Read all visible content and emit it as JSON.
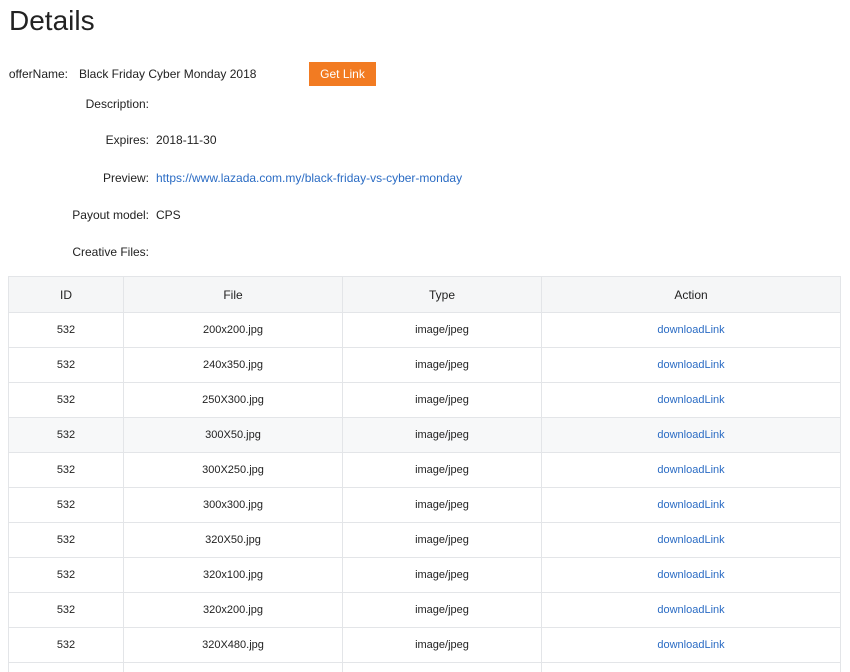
{
  "page": {
    "title": "Details"
  },
  "details": {
    "offer_name_label": "offerName:",
    "offer_name_value": "Black Friday Cyber Monday 2018",
    "get_link_label": "Get Link",
    "description_label": "Description:",
    "description_value": "",
    "expires_label": "Expires:",
    "expires_value": "2018-11-30",
    "preview_label": "Preview:",
    "preview_value": "https://www.lazada.com.my/black-friday-vs-cyber-monday",
    "payout_label": "Payout model:",
    "payout_value": "CPS",
    "creative_label": "Creative Files:"
  },
  "table": {
    "columns": [
      "ID",
      "File",
      "Type",
      "Action"
    ],
    "rows": [
      {
        "id": "532",
        "file": "200x200.jpg",
        "type": "image/jpeg",
        "action": "downloadLink"
      },
      {
        "id": "532",
        "file": "240x350.jpg",
        "type": "image/jpeg",
        "action": "downloadLink"
      },
      {
        "id": "532",
        "file": "250X300.jpg",
        "type": "image/jpeg",
        "action": "downloadLink"
      },
      {
        "id": "532",
        "file": "300X50.jpg",
        "type": "image/jpeg",
        "action": "downloadLink"
      },
      {
        "id": "532",
        "file": "300X250.jpg",
        "type": "image/jpeg",
        "action": "downloadLink"
      },
      {
        "id": "532",
        "file": "300x300.jpg",
        "type": "image/jpeg",
        "action": "downloadLink"
      },
      {
        "id": "532",
        "file": "320X50.jpg",
        "type": "image/jpeg",
        "action": "downloadLink"
      },
      {
        "id": "532",
        "file": "320x100.jpg",
        "type": "image/jpeg",
        "action": "downloadLink"
      },
      {
        "id": "532",
        "file": "320x200.jpg",
        "type": "image/jpeg",
        "action": "downloadLink"
      },
      {
        "id": "532",
        "file": "320X480.jpg",
        "type": "image/jpeg",
        "action": "downloadLink"
      },
      {
        "id": "",
        "file": "",
        "type": "",
        "action": ""
      }
    ]
  },
  "colors": {
    "accent_button": "#f27b22",
    "link": "#2b6cc4",
    "header_bg": "#f5f6f7",
    "border": "#e3e5e8"
  }
}
